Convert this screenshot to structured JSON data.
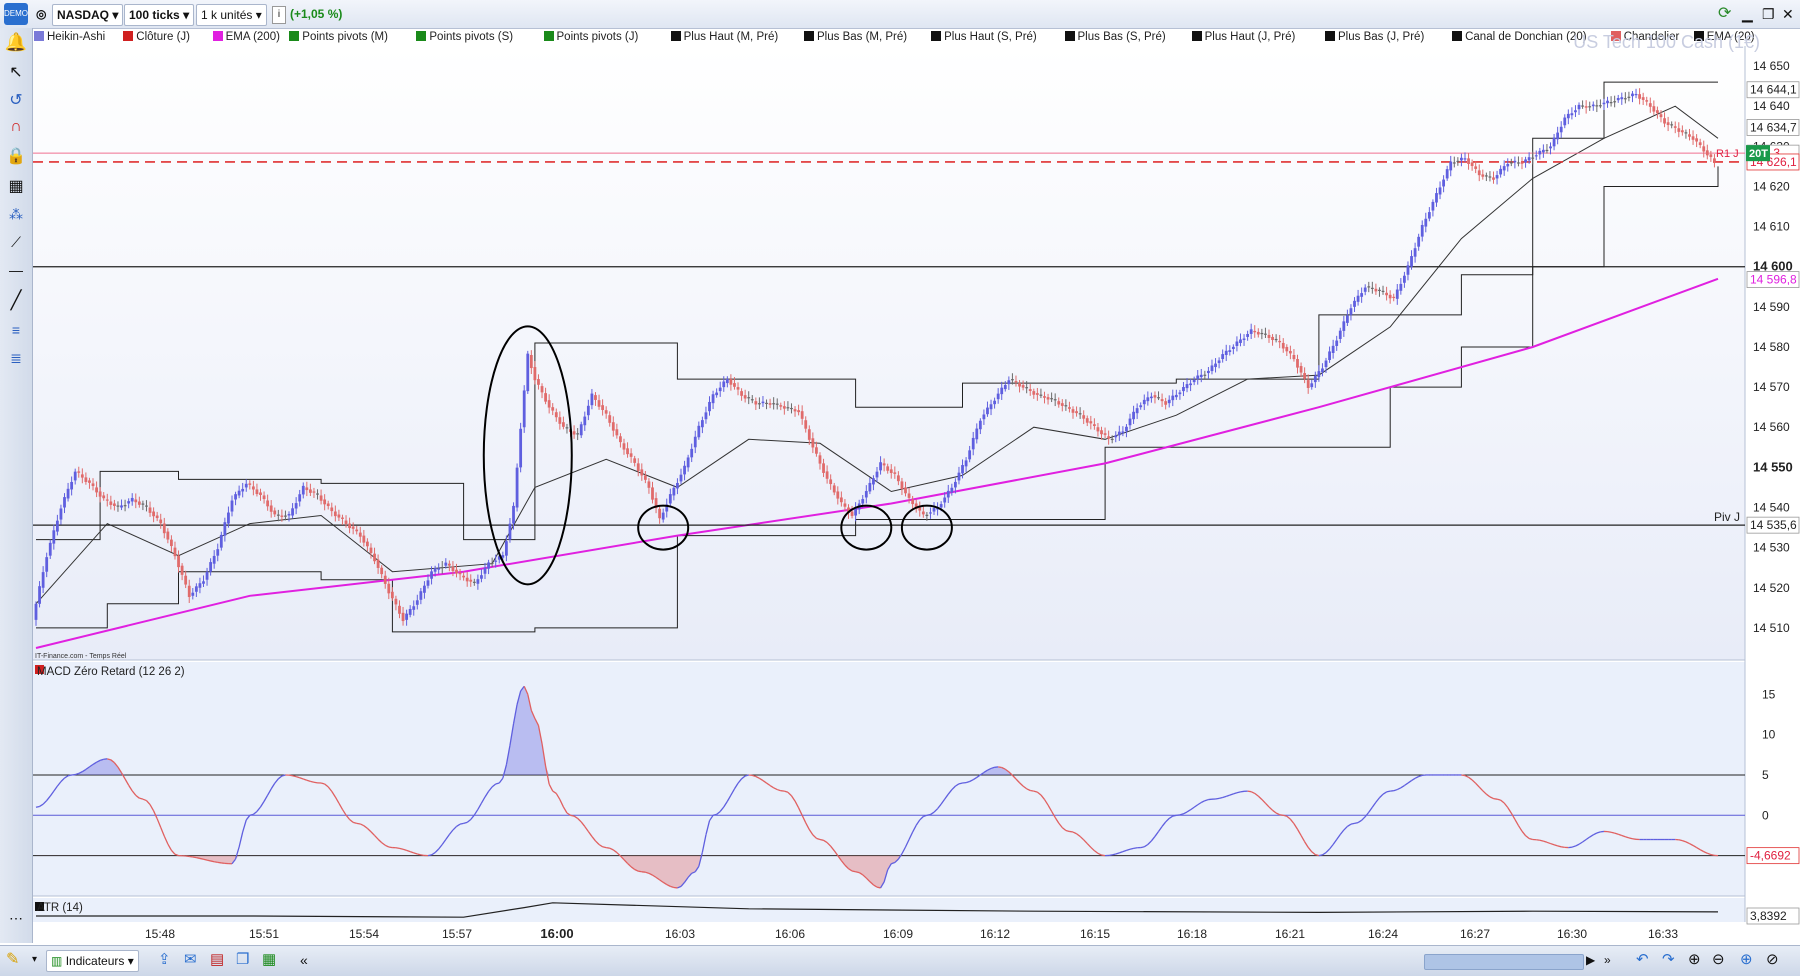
{
  "toolbar": {
    "symbol": "NASDAQ",
    "timeframe": "100 ticks",
    "units": "1 k unités",
    "change": "(+1,05 %)",
    "demo_badge": "DEMO"
  },
  "legend": {
    "items": [
      {
        "label": "Heikin-Ashi",
        "color": "#7a7ad8"
      },
      {
        "label": "Clôture (J)",
        "color": "#d02020"
      },
      {
        "label": "EMA (200)",
        "color": "#e020e0"
      },
      {
        "label": "Points pivots (M)",
        "color": "#1a8a1a"
      },
      {
        "label": "Points pivots (S)",
        "color": "#1a8a1a"
      },
      {
        "label": "Points pivots (J)",
        "color": "#1a8a1a"
      },
      {
        "label": "Plus Haut (M, Pré)",
        "color": "#111111"
      },
      {
        "label": "Plus Bas (M, Pré)",
        "color": "#111111"
      },
      {
        "label": "Plus Haut (S, Pré)",
        "color": "#111111"
      },
      {
        "label": "Plus Bas (S, Pré)",
        "color": "#111111"
      },
      {
        "label": "Plus Haut (J, Pré)",
        "color": "#111111"
      },
      {
        "label": "Plus Bas (J, Pré)",
        "color": "#111111"
      },
      {
        "label": "Canal de Donchian (20)",
        "color": "#111111"
      },
      {
        "label": "Chandelier",
        "color": "#e06060"
      },
      {
        "label": "EMA (20)",
        "color": "#111111"
      }
    ],
    "watermark": "US Tech 100 Cash (1€)"
  },
  "markers": {
    "source": "IT-Finance.com - Temps Réel",
    "piv_label": "Piv J",
    "r1_label": "R1 J",
    "badge": "20T"
  },
  "colors": {
    "bull": "#5f5fdf",
    "bear": "#e06b6b",
    "neutral": "#6a6a6a",
    "ema200": "#e020e0",
    "dashed": "#e03030",
    "macd_pos": "#5f5fdf",
    "macd_neg": "#e06060"
  },
  "chart_data": [
    {
      "type": "candlestick",
      "title": "NASDAQ",
      "ylim": [
        14502,
        14655
      ],
      "y_ticks": [
        "14 650",
        "14 640",
        "14 630",
        "14 620",
        "14 610",
        "14 600",
        "14 590",
        "14 580",
        "14 570",
        "14 560",
        "14 550",
        "14 540",
        "14 530",
        "14 520",
        "14 510"
      ],
      "y_ticks_bold": [
        "14 600",
        "14 550"
      ],
      "x_ticks": [
        "15:48",
        "15:51",
        "15:54",
        "15:57",
        "16:00",
        "16:03",
        "16:06",
        "16:09",
        "16:12",
        "16:15",
        "16:18",
        "16:21",
        "16:24",
        "16:27",
        "16:30",
        "16:33"
      ],
      "x_tick_bold": "16:00",
      "close_path": [
        [
          0,
          14512
        ],
        [
          4,
          14528
        ],
        [
          8,
          14540
        ],
        [
          12,
          14549
        ],
        [
          16,
          14546
        ],
        [
          20,
          14542
        ],
        [
          24,
          14540
        ],
        [
          28,
          14542
        ],
        [
          32,
          14540
        ],
        [
          36,
          14536
        ],
        [
          40,
          14528
        ],
        [
          44,
          14518
        ],
        [
          48,
          14522
        ],
        [
          52,
          14530
        ],
        [
          56,
          14542
        ],
        [
          60,
          14546
        ],
        [
          64,
          14543
        ],
        [
          68,
          14538
        ],
        [
          72,
          14538
        ],
        [
          76,
          14545
        ],
        [
          80,
          14543
        ],
        [
          84,
          14539
        ],
        [
          88,
          14536
        ],
        [
          92,
          14533
        ],
        [
          96,
          14527
        ],
        [
          100,
          14519
        ],
        [
          104,
          14512
        ],
        [
          108,
          14517
        ],
        [
          112,
          14524
        ],
        [
          116,
          14526
        ],
        [
          120,
          14523
        ],
        [
          124,
          14521
        ],
        [
          128,
          14526
        ],
        [
          132,
          14528
        ],
        [
          135,
          14540
        ],
        [
          137,
          14560
        ],
        [
          139,
          14578
        ],
        [
          141,
          14572
        ],
        [
          145,
          14565
        ],
        [
          149,
          14560
        ],
        [
          153,
          14558
        ],
        [
          157,
          14568
        ],
        [
          161,
          14563
        ],
        [
          165,
          14556
        ],
        [
          169,
          14551
        ],
        [
          173,
          14545
        ],
        [
          176,
          14537
        ],
        [
          179,
          14543
        ],
        [
          183,
          14550
        ],
        [
          187,
          14560
        ],
        [
          191,
          14568
        ],
        [
          195,
          14572
        ],
        [
          199,
          14568
        ],
        [
          203,
          14566
        ],
        [
          207,
          14566
        ],
        [
          211,
          14565
        ],
        [
          215,
          14564
        ],
        [
          219,
          14555
        ],
        [
          223,
          14547
        ],
        [
          227,
          14541
        ],
        [
          230,
          14538
        ],
        [
          234,
          14544
        ],
        [
          238,
          14551
        ],
        [
          242,
          14548
        ],
        [
          246,
          14542
        ],
        [
          250,
          14538
        ],
        [
          254,
          14540
        ],
        [
          258,
          14545
        ],
        [
          262,
          14552
        ],
        [
          266,
          14562
        ],
        [
          270,
          14567
        ],
        [
          274,
          14572
        ],
        [
          278,
          14570
        ],
        [
          282,
          14568
        ],
        [
          286,
          14567
        ],
        [
          290,
          14565
        ],
        [
          294,
          14563
        ],
        [
          298,
          14560
        ],
        [
          302,
          14557
        ],
        [
          306,
          14559
        ],
        [
          310,
          14565
        ],
        [
          314,
          14568
        ],
        [
          318,
          14566
        ],
        [
          322,
          14569
        ],
        [
          326,
          14572
        ],
        [
          330,
          14574
        ],
        [
          334,
          14578
        ],
        [
          338,
          14581
        ],
        [
          342,
          14584
        ],
        [
          346,
          14583
        ],
        [
          350,
          14581
        ],
        [
          354,
          14577
        ],
        [
          358,
          14570
        ],
        [
          362,
          14575
        ],
        [
          366,
          14582
        ],
        [
          370,
          14590
        ],
        [
          374,
          14595
        ],
        [
          378,
          14594
        ],
        [
          382,
          14592
        ],
        [
          386,
          14600
        ],
        [
          390,
          14610
        ],
        [
          394,
          14618
        ],
        [
          398,
          14626
        ],
        [
          402,
          14627
        ],
        [
          406,
          14623
        ],
        [
          410,
          14622
        ],
        [
          414,
          14626
        ],
        [
          418,
          14626
        ],
        [
          422,
          14628
        ],
        [
          426,
          14630
        ],
        [
          430,
          14637
        ],
        [
          434,
          14640
        ],
        [
          438,
          14640
        ],
        [
          442,
          14641
        ],
        [
          446,
          14642
        ],
        [
          450,
          14643
        ],
        [
          454,
          14640
        ],
        [
          458,
          14636
        ],
        [
          462,
          14634
        ],
        [
          466,
          14632
        ],
        [
          470,
          14628
        ],
        [
          472,
          14626
        ]
      ],
      "ema200": [
        [
          0,
          14505
        ],
        [
          60,
          14518
        ],
        [
          120,
          14524
        ],
        [
          180,
          14533
        ],
        [
          240,
          14541
        ],
        [
          300,
          14551
        ],
        [
          360,
          14565
        ],
        [
          420,
          14580
        ],
        [
          472,
          14597
        ]
      ],
      "ema20": [
        [
          0,
          14516
        ],
        [
          20,
          14536
        ],
        [
          40,
          14528
        ],
        [
          60,
          14536
        ],
        [
          80,
          14538
        ],
        [
          100,
          14524
        ],
        [
          128,
          14526
        ],
        [
          140,
          14545
        ],
        [
          160,
          14552
        ],
        [
          180,
          14545
        ],
        [
          200,
          14557
        ],
        [
          220,
          14556
        ],
        [
          240,
          14544
        ],
        [
          260,
          14548
        ],
        [
          280,
          14560
        ],
        [
          300,
          14557
        ],
        [
          320,
          14563
        ],
        [
          340,
          14572
        ],
        [
          360,
          14573
        ],
        [
          380,
          14585
        ],
        [
          400,
          14607
        ],
        [
          420,
          14622
        ],
        [
          440,
          14632
        ],
        [
          460,
          14640
        ],
        [
          472,
          14632
        ]
      ],
      "donchian_upper": [
        [
          0,
          14532
        ],
        [
          18,
          14549
        ],
        [
          40,
          14547
        ],
        [
          80,
          14546
        ],
        [
          120,
          14532
        ],
        [
          140,
          14581
        ],
        [
          180,
          14572
        ],
        [
          230,
          14565
        ],
        [
          260,
          14571
        ],
        [
          320,
          14572
        ],
        [
          360,
          14588
        ],
        [
          400,
          14598
        ],
        [
          420,
          14632
        ],
        [
          440,
          14646
        ],
        [
          472,
          14646
        ]
      ],
      "donchian_lower": [
        [
          0,
          14510
        ],
        [
          20,
          14516
        ],
        [
          40,
          14524
        ],
        [
          80,
          14522
        ],
        [
          100,
          14509
        ],
        [
          140,
          14510
        ],
        [
          180,
          14533
        ],
        [
          230,
          14537
        ],
        [
          260,
          14537
        ],
        [
          300,
          14555
        ],
        [
          340,
          14555
        ],
        [
          380,
          14570
        ],
        [
          400,
          14580
        ],
        [
          420,
          14600
        ],
        [
          440,
          14620
        ],
        [
          472,
          14625
        ]
      ],
      "hlines": [
        {
          "label": "14 600",
          "value": 14600,
          "style": "solid"
        },
        {
          "label": "Piv J",
          "value": 14535.6,
          "style": "solid",
          "tag": "14 535,6"
        },
        {
          "label": "R1 J",
          "value": 14628.3,
          "style": "solid-pink",
          "tag": "128,3"
        },
        {
          "label": "dashed",
          "value": 14626.1,
          "style": "dashed-red",
          "tag": "14 626,1"
        }
      ],
      "price_tags": [
        "14 644,1",
        "14 634,7",
        "14 596,8"
      ],
      "annotations": [
        {
          "shape": "ellipse",
          "x": 138,
          "y": 14553
        },
        {
          "shape": "circle",
          "x": 176,
          "y": 14535
        },
        {
          "shape": "circle",
          "x": 233,
          "y": 14535
        },
        {
          "shape": "circle",
          "x": 250,
          "y": 14535
        }
      ]
    },
    {
      "type": "area",
      "title": "MACD Zéro Retard (12 26 2)",
      "ylim": [
        -10,
        19
      ],
      "y_ticks": [
        "15",
        "10",
        "5",
        "0"
      ],
      "last_value": "-4,6692",
      "levels": [
        5,
        0,
        -5
      ],
      "x": [
        0,
        10,
        20,
        30,
        40,
        55,
        60,
        70,
        80,
        90,
        100,
        110,
        120,
        130,
        137,
        140,
        145,
        150,
        160,
        170,
        180,
        185,
        190,
        200,
        210,
        220,
        230,
        237,
        240,
        250,
        260,
        270,
        280,
        290,
        300,
        310,
        320,
        330,
        340,
        350,
        360,
        370,
        380,
        390,
        400,
        410,
        420,
        430,
        440,
        450,
        460,
        472
      ],
      "values": [
        1,
        5,
        7,
        2,
        -5,
        -6,
        0,
        5,
        4,
        -1,
        -4,
        -5,
        -1,
        4,
        16,
        12,
        3,
        0,
        -4,
        -7,
        -9,
        -7,
        0,
        5,
        3,
        -3,
        -7,
        -9,
        -6,
        0,
        4,
        6,
        3,
        -2,
        -5,
        -4,
        0,
        2,
        3,
        0,
        -5,
        -1,
        3,
        5,
        5,
        2,
        -3,
        -4,
        -2,
        -3,
        -3,
        -5
      ]
    },
    {
      "type": "line",
      "title": "ATR (14)",
      "last_value": "3,8392",
      "x": [
        0,
        60,
        120,
        137,
        145,
        200,
        280,
        360,
        420,
        472
      ],
      "values": [
        3.5,
        3.5,
        3.4,
        4.2,
        4.6,
        4.1,
        3.9,
        3.8,
        3.9,
        3.84
      ]
    }
  ],
  "bottom": {
    "indicators_label": "Indicateurs"
  }
}
